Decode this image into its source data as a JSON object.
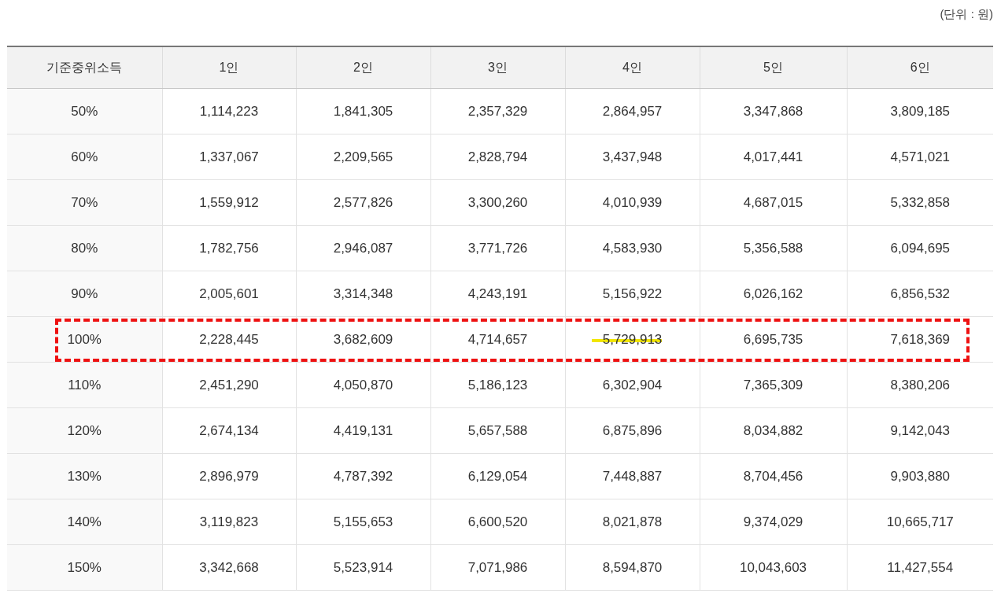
{
  "unit_note": "(단위 : 원)",
  "table": {
    "columns": [
      "기준중위소득",
      "1인",
      "2인",
      "3인",
      "4인",
      "5인",
      "6인"
    ],
    "rows": [
      {
        "highlighted": false,
        "cells": [
          {
            "text": "50%",
            "marked": false
          },
          {
            "text": "1,114,223",
            "marked": false
          },
          {
            "text": "1,841,305",
            "marked": false
          },
          {
            "text": "2,357,329",
            "marked": false
          },
          {
            "text": "2,864,957",
            "marked": false
          },
          {
            "text": "3,347,868",
            "marked": false
          },
          {
            "text": "3,809,185",
            "marked": false
          }
        ]
      },
      {
        "highlighted": false,
        "cells": [
          {
            "text": "60%",
            "marked": false
          },
          {
            "text": "1,337,067",
            "marked": false
          },
          {
            "text": "2,209,565",
            "marked": false
          },
          {
            "text": "2,828,794",
            "marked": false
          },
          {
            "text": "3,437,948",
            "marked": false
          },
          {
            "text": "4,017,441",
            "marked": false
          },
          {
            "text": "4,571,021",
            "marked": false
          }
        ]
      },
      {
        "highlighted": false,
        "cells": [
          {
            "text": "70%",
            "marked": false
          },
          {
            "text": "1,559,912",
            "marked": false
          },
          {
            "text": "2,577,826",
            "marked": false
          },
          {
            "text": "3,300,260",
            "marked": false
          },
          {
            "text": "4,010,939",
            "marked": false
          },
          {
            "text": "4,687,015",
            "marked": false
          },
          {
            "text": "5,332,858",
            "marked": false
          }
        ]
      },
      {
        "highlighted": false,
        "cells": [
          {
            "text": "80%",
            "marked": false
          },
          {
            "text": "1,782,756",
            "marked": false
          },
          {
            "text": "2,946,087",
            "marked": false
          },
          {
            "text": "3,771,726",
            "marked": false
          },
          {
            "text": "4,583,930",
            "marked": false
          },
          {
            "text": "5,356,588",
            "marked": false
          },
          {
            "text": "6,094,695",
            "marked": false
          }
        ]
      },
      {
        "highlighted": false,
        "cells": [
          {
            "text": "90%",
            "marked": false
          },
          {
            "text": "2,005,601",
            "marked": false
          },
          {
            "text": "3,314,348",
            "marked": false
          },
          {
            "text": "4,243,191",
            "marked": false
          },
          {
            "text": "5,156,922",
            "marked": false
          },
          {
            "text": "6,026,162",
            "marked": false
          },
          {
            "text": "6,856,532",
            "marked": false
          }
        ]
      },
      {
        "highlighted": true,
        "cells": [
          {
            "text": "100%",
            "marked": false
          },
          {
            "text": "2,228,445",
            "marked": false
          },
          {
            "text": "3,682,609",
            "marked": false
          },
          {
            "text": "4,714,657",
            "marked": false
          },
          {
            "text": "5,729,913",
            "marked": true
          },
          {
            "text": "6,695,735",
            "marked": false
          },
          {
            "text": "7,618,369",
            "marked": false
          }
        ]
      },
      {
        "highlighted": false,
        "cells": [
          {
            "text": "110%",
            "marked": false
          },
          {
            "text": "2,451,290",
            "marked": false
          },
          {
            "text": "4,050,870",
            "marked": false
          },
          {
            "text": "5,186,123",
            "marked": false
          },
          {
            "text": "6,302,904",
            "marked": false
          },
          {
            "text": "7,365,309",
            "marked": false
          },
          {
            "text": "8,380,206",
            "marked": false
          }
        ]
      },
      {
        "highlighted": false,
        "cells": [
          {
            "text": "120%",
            "marked": false
          },
          {
            "text": "2,674,134",
            "marked": false
          },
          {
            "text": "4,419,131",
            "marked": false
          },
          {
            "text": "5,657,588",
            "marked": false
          },
          {
            "text": "6,875,896",
            "marked": false
          },
          {
            "text": "8,034,882",
            "marked": false
          },
          {
            "text": "9,142,043",
            "marked": false
          }
        ]
      },
      {
        "highlighted": false,
        "cells": [
          {
            "text": "130%",
            "marked": false
          },
          {
            "text": "2,896,979",
            "marked": false
          },
          {
            "text": "4,787,392",
            "marked": false
          },
          {
            "text": "6,129,054",
            "marked": false
          },
          {
            "text": "7,448,887",
            "marked": false
          },
          {
            "text": "8,704,456",
            "marked": false
          },
          {
            "text": "9,903,880",
            "marked": false
          }
        ]
      },
      {
        "highlighted": false,
        "cells": [
          {
            "text": "140%",
            "marked": false
          },
          {
            "text": "3,119,823",
            "marked": false
          },
          {
            "text": "5,155,653",
            "marked": false
          },
          {
            "text": "6,600,520",
            "marked": false
          },
          {
            "text": "8,021,878",
            "marked": false
          },
          {
            "text": "9,374,029",
            "marked": false
          },
          {
            "text": "10,665,717",
            "marked": false
          }
        ]
      },
      {
        "highlighted": false,
        "cells": [
          {
            "text": "150%",
            "marked": false
          },
          {
            "text": "3,342,668",
            "marked": false
          },
          {
            "text": "5,523,914",
            "marked": false
          },
          {
            "text": "7,071,986",
            "marked": false
          },
          {
            "text": "8,594,870",
            "marked": false
          },
          {
            "text": "10,043,603",
            "marked": false
          },
          {
            "text": "11,427,554",
            "marked": false
          }
        ]
      }
    ]
  }
}
